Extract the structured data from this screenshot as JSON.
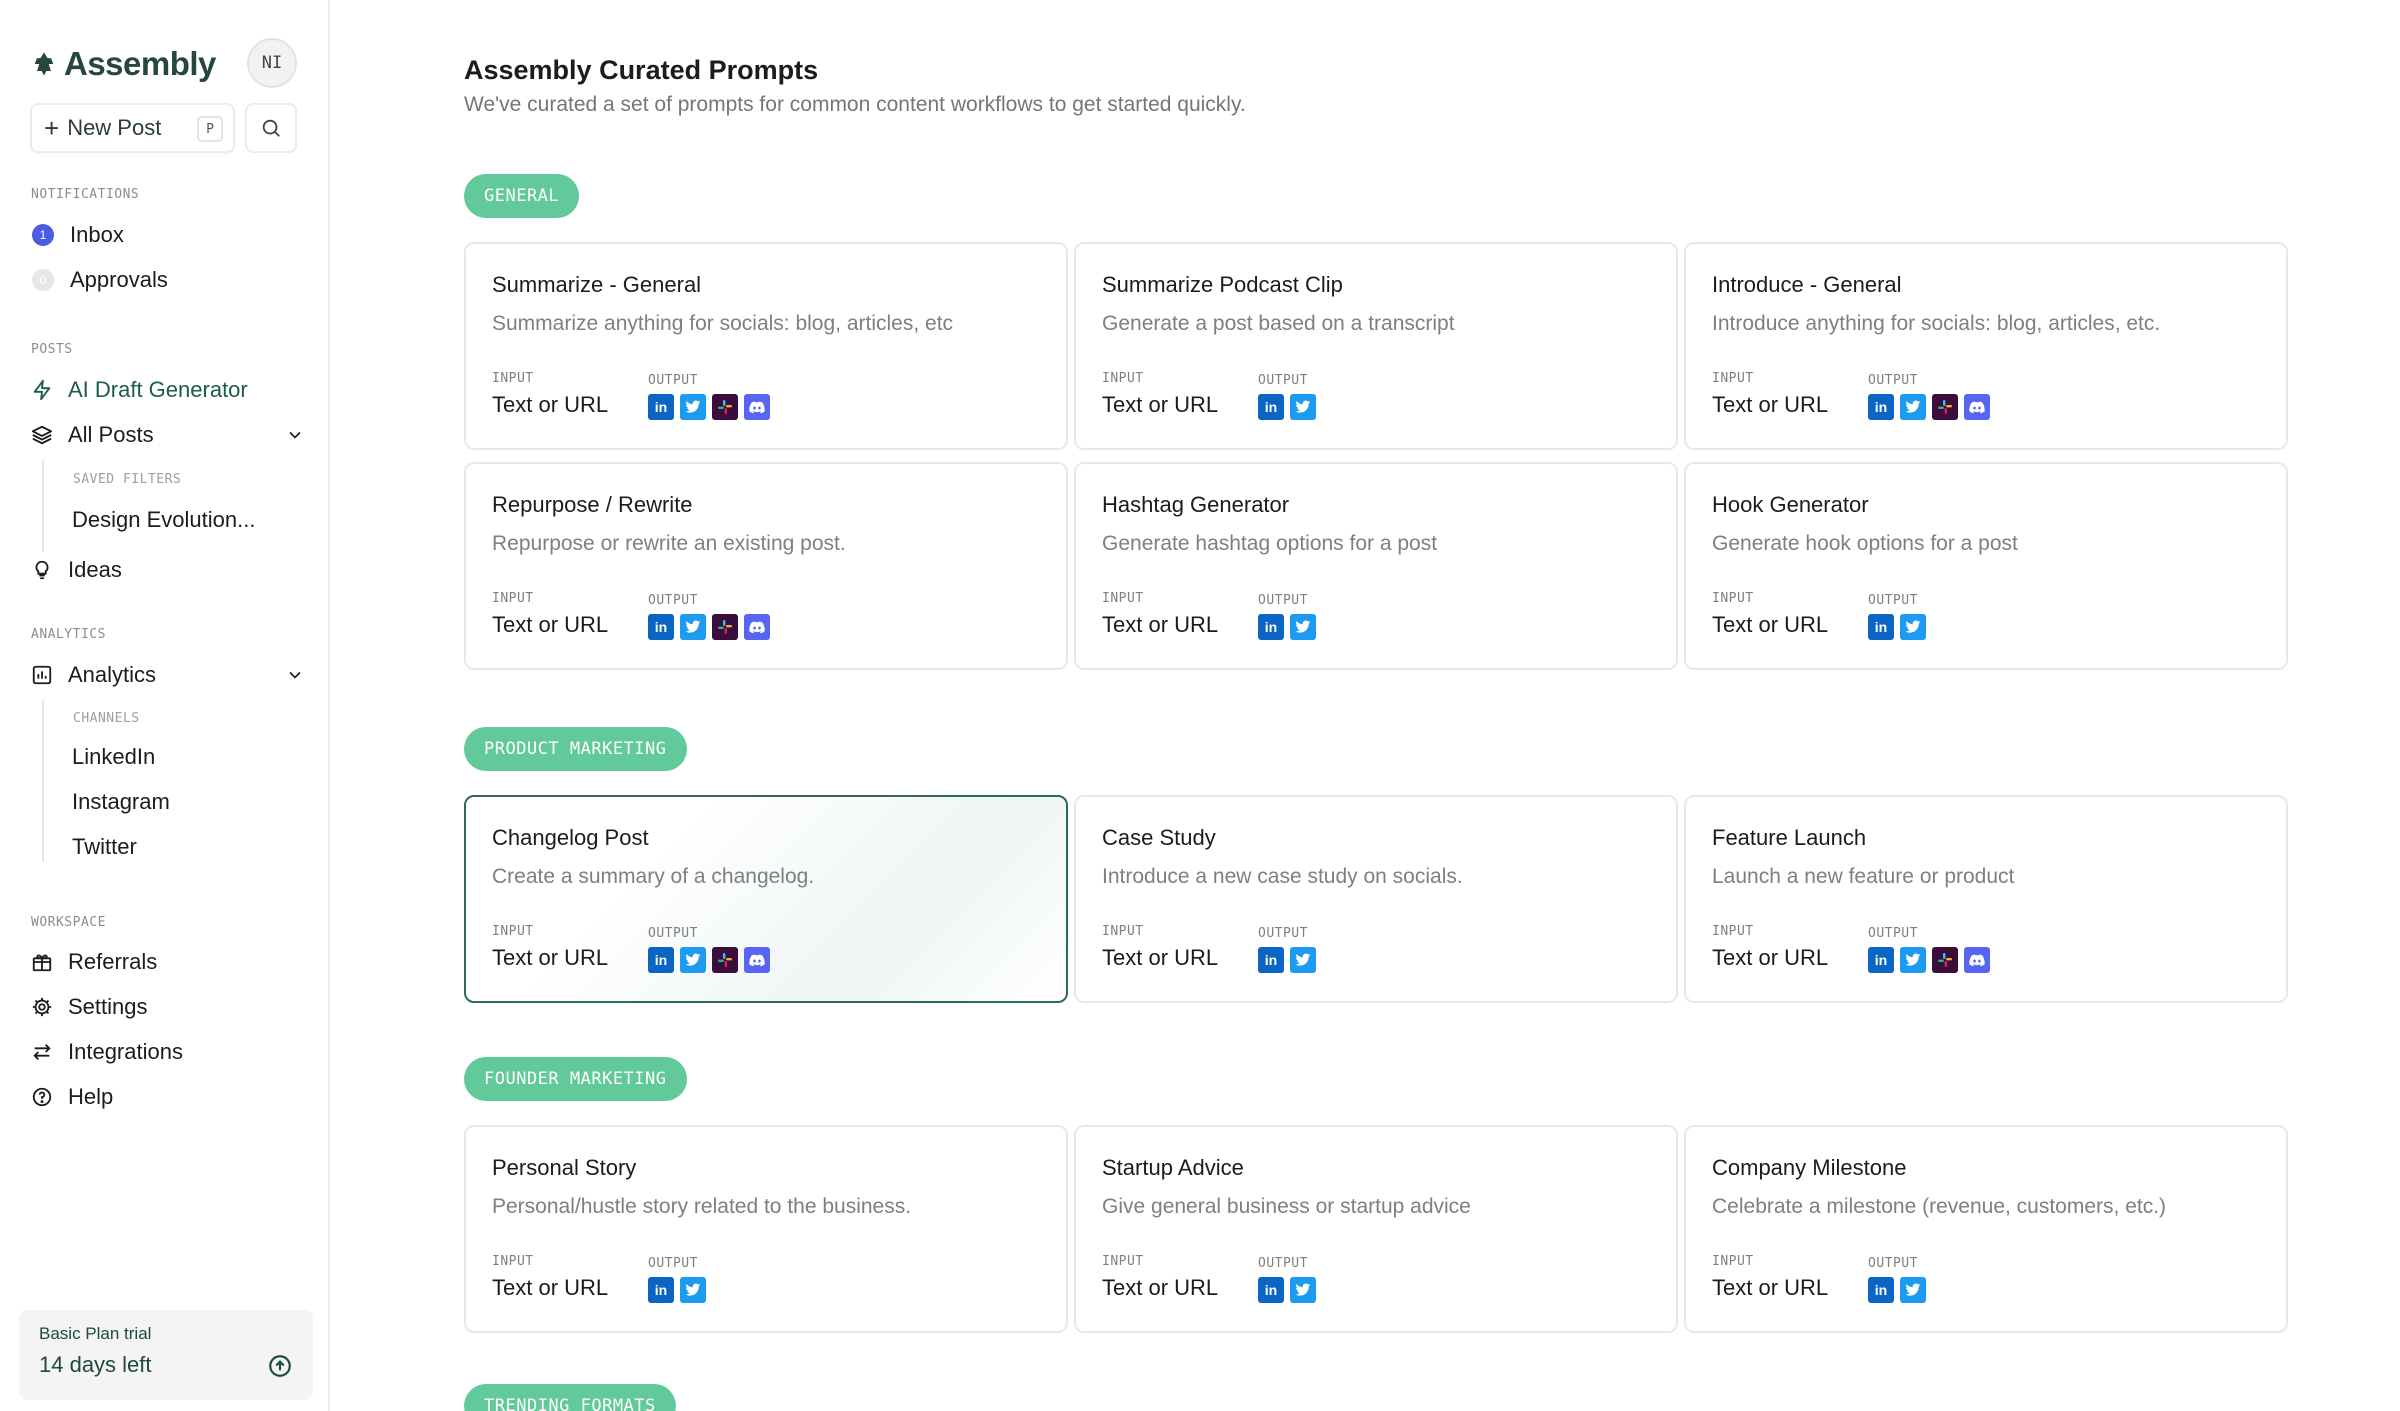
{
  "sidebar": {
    "brand": "Assembly",
    "avatar": "NI",
    "new_post": "New Post",
    "new_post_shortcut": "P",
    "notifications_label": "NOTIFICATIONS",
    "inbox": {
      "label": "Inbox",
      "count": "1"
    },
    "approvals": {
      "label": "Approvals",
      "count": "0"
    },
    "posts_label": "POSTS",
    "ai_draft": "AI Draft Generator",
    "all_posts": "All Posts",
    "saved_filters_label": "SAVED FILTERS",
    "saved_filter_1": "Design Evolution...",
    "ideas": "Ideas",
    "analytics_label": "ANALYTICS",
    "analytics": "Analytics",
    "channels_label": "CHANNELS",
    "channels": [
      "LinkedIn",
      "Instagram",
      "Twitter"
    ],
    "workspace_label": "WORKSPACE",
    "referrals": "Referrals",
    "settings": "Settings",
    "integrations": "Integrations",
    "help": "Help",
    "trial_title": "Basic Plan trial",
    "trial_days": "14 days left"
  },
  "main": {
    "title": "Assembly Curated Prompts",
    "subtitle": "We've curated a set of prompts for common content workflows to get started quickly.",
    "input_label": "INPUT",
    "output_label": "OUTPUT",
    "sections": [
      {
        "label": "GENERAL",
        "cards": [
          {
            "title": "Summarize - General",
            "desc": "Summarize anything for socials: blog, articles, etc",
            "input": "Text or URL",
            "outputs": [
              "linkedin",
              "twitter",
              "slack",
              "discord"
            ]
          },
          {
            "title": "Summarize Podcast Clip",
            "desc": "Generate a post based on a transcript",
            "input": "Text or URL",
            "outputs": [
              "linkedin",
              "twitter"
            ]
          },
          {
            "title": "Introduce - General",
            "desc": "Introduce anything for socials: blog, articles, etc.",
            "input": "Text or URL",
            "outputs": [
              "linkedin",
              "twitter",
              "slack",
              "discord"
            ]
          },
          {
            "title": "Repurpose / Rewrite",
            "desc": "Repurpose or rewrite an existing post.",
            "input": "Text or URL",
            "outputs": [
              "linkedin",
              "twitter",
              "slack",
              "discord"
            ]
          },
          {
            "title": "Hashtag Generator",
            "desc": "Generate hashtag options for a post",
            "input": "Text or URL",
            "outputs": [
              "linkedin",
              "twitter"
            ]
          },
          {
            "title": "Hook Generator",
            "desc": "Generate hook options for a post",
            "input": "Text or URL",
            "outputs": [
              "linkedin",
              "twitter"
            ]
          }
        ]
      },
      {
        "label": "PRODUCT MARKETING",
        "cards": [
          {
            "title": "Changelog Post",
            "desc": "Create a summary of a changelog.",
            "input": "Text or URL",
            "outputs": [
              "linkedin",
              "twitter",
              "slack",
              "discord"
            ]
          },
          {
            "title": "Case Study",
            "desc": "Introduce a new case study on socials.",
            "input": "Text or URL",
            "outputs": [
              "linkedin",
              "twitter"
            ]
          },
          {
            "title": "Feature Launch",
            "desc": "Launch a new feature or product",
            "input": "Text or URL",
            "outputs": [
              "linkedin",
              "twitter",
              "slack",
              "discord"
            ]
          }
        ]
      },
      {
        "label": "FOUNDER MARKETING",
        "cards": [
          {
            "title": "Personal Story",
            "desc": "Personal/hustle story related to the business.",
            "input": "Text or URL",
            "outputs": [
              "linkedin",
              "twitter"
            ]
          },
          {
            "title": "Startup Advice",
            "desc": "Give general business or startup advice",
            "input": "Text or URL",
            "outputs": [
              "linkedin",
              "twitter"
            ]
          },
          {
            "title": "Company Milestone",
            "desc": "Celebrate a milestone (revenue, customers, etc.)",
            "input": "Text or URL",
            "outputs": [
              "linkedin",
              "twitter"
            ]
          }
        ]
      },
      {
        "label": "TRENDING FORMATS",
        "cards": []
      }
    ]
  },
  "colors": {
    "accent_green": "#61c99a",
    "brand_dark": "#27473a",
    "inbox_badge": "#4a5ce6",
    "active_card_border": "#2f6a52"
  }
}
